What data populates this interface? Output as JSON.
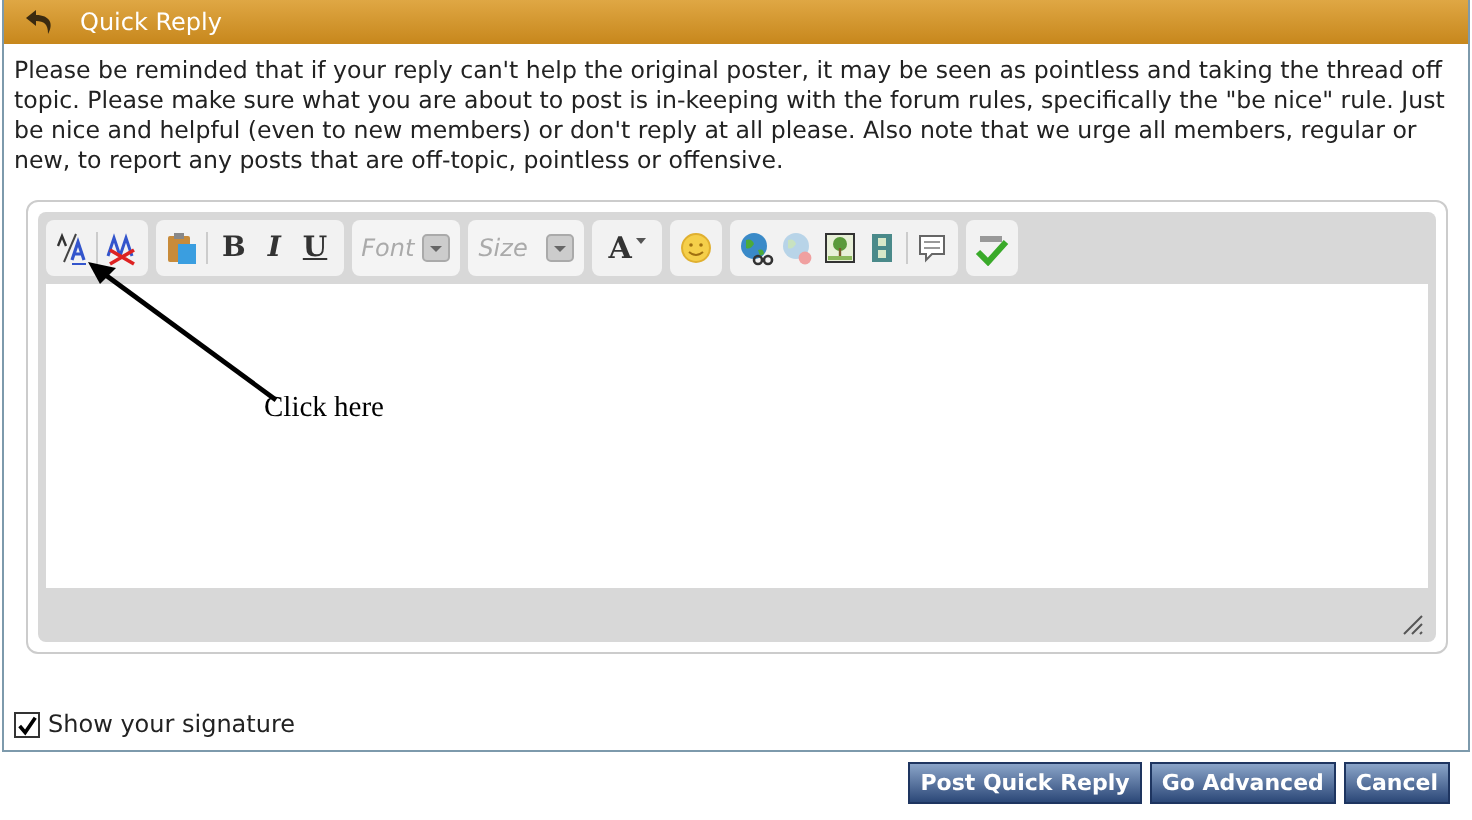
{
  "panel": {
    "title": "Quick Reply"
  },
  "notice": "Please be reminded that if your reply can't help the original poster, it may be seen as pointless and taking the thread off topic. Please make sure what you are about to post is in-keeping with the forum rules, specifically the \"be nice\" rule. Just be nice and helpful (even to new members) or don't reply at all please. Also note that we urge all members, regular or new, to report any posts that are off-topic, pointless or offensive.",
  "toolbar": [
    {
      "kind": "group",
      "items": [
        {
          "kind": "icon"
        },
        {
          "kind": "sep"
        },
        {
          "kind": "icon"
        }
      ]
    },
    {
      "kind": "group",
      "items": [
        {
          "kind": "icon"
        },
        {
          "kind": "sep"
        },
        {
          "kind": "text",
          "label": "B"
        },
        {
          "kind": "text",
          "label": "I"
        },
        {
          "kind": "text",
          "label": "U"
        }
      ]
    },
    {
      "kind": "select",
      "placeholder": "Font"
    },
    {
      "kind": "select",
      "placeholder": "Size"
    },
    {
      "kind": "group",
      "items": [
        {
          "kind": "color",
          "label": "A"
        }
      ]
    },
    {
      "kind": "group",
      "items": [
        {
          "kind": "icon"
        }
      ]
    },
    {
      "kind": "group",
      "items": [
        {
          "kind": "icon"
        },
        {
          "kind": "icon"
        },
        {
          "kind": "icon"
        },
        {
          "kind": "icon"
        },
        {
          "kind": "sep"
        },
        {
          "kind": "icon"
        }
      ]
    },
    {
      "kind": "group",
      "items": [
        {
          "kind": "icon"
        }
      ]
    }
  ],
  "annotation": {
    "text": "Click here"
  },
  "signature": {
    "label": "Show your signature",
    "checked": true
  },
  "buttons": [
    "Post Quick Reply",
    "Go Advanced",
    "Cancel"
  ]
}
